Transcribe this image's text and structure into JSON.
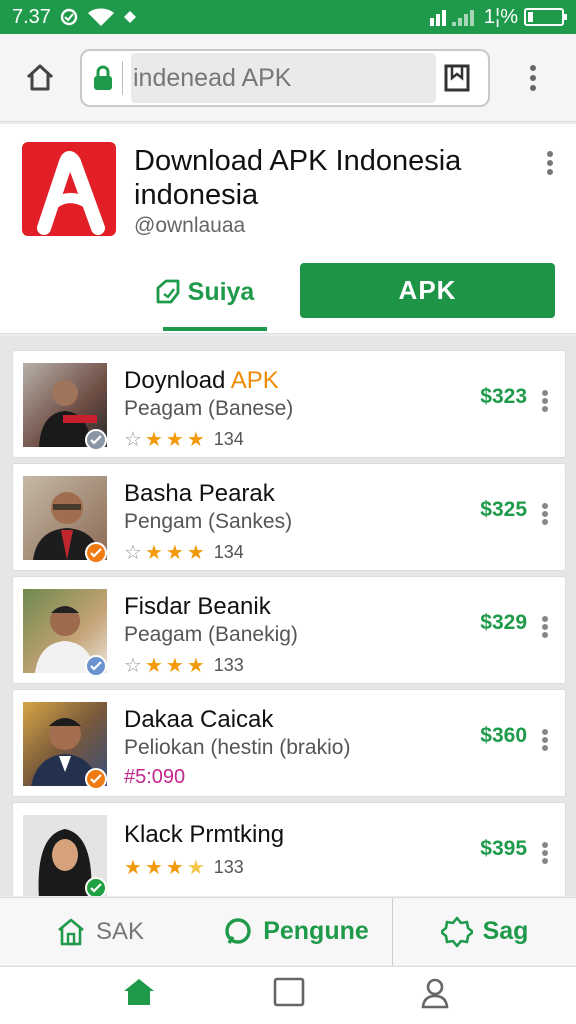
{
  "status_bar": {
    "time": "7.37",
    "battery": "1¦%",
    "battery_level": 0.15
  },
  "browser": {
    "url": "indenead APK"
  },
  "app": {
    "title": "Download APK Indonesia indonesia",
    "handle": "@ownlauaa",
    "tab_label": "Suiya",
    "apk_button": "APK"
  },
  "list": [
    {
      "name_pre": "Doynload ",
      "name_hl": "APK",
      "sub": "Peagam (Banese)",
      "stars": 3,
      "count": "134",
      "price": "$323",
      "badge_color": "#8a96a6"
    },
    {
      "name_pre": "Basha Pearak",
      "name_hl": "",
      "sub": "Pengam (Sankes)",
      "stars": 3,
      "count": "134",
      "price": "$325",
      "badge_color": "#f07b12"
    },
    {
      "name_pre": "Fisdar Beanik",
      "name_hl": "",
      "sub": "Peagam (Banekig)",
      "stars": 3,
      "count": "133",
      "price": "$329",
      "badge_color": "#6a93cf"
    },
    {
      "name_pre": "Dakaa Caicak",
      "name_hl": "",
      "sub": "Peliokan (hestin (brakio)",
      "code": "#5:090",
      "price": "$360",
      "badge_color": "#f07b12"
    },
    {
      "name_pre": "Klack Prmtking",
      "name_hl": "",
      "sub": "",
      "stars": 4,
      "count": "133",
      "price": "$395",
      "badge_color": "#1fa142"
    }
  ],
  "action_bar": {
    "left": "SAK",
    "center": "Pengune",
    "right": "Sag"
  },
  "colors": {
    "brand_green": "#1f9a4b",
    "logo_red": "#e21f26",
    "accent_orange": "#f08a00",
    "code_magenta": "#c2278c"
  }
}
